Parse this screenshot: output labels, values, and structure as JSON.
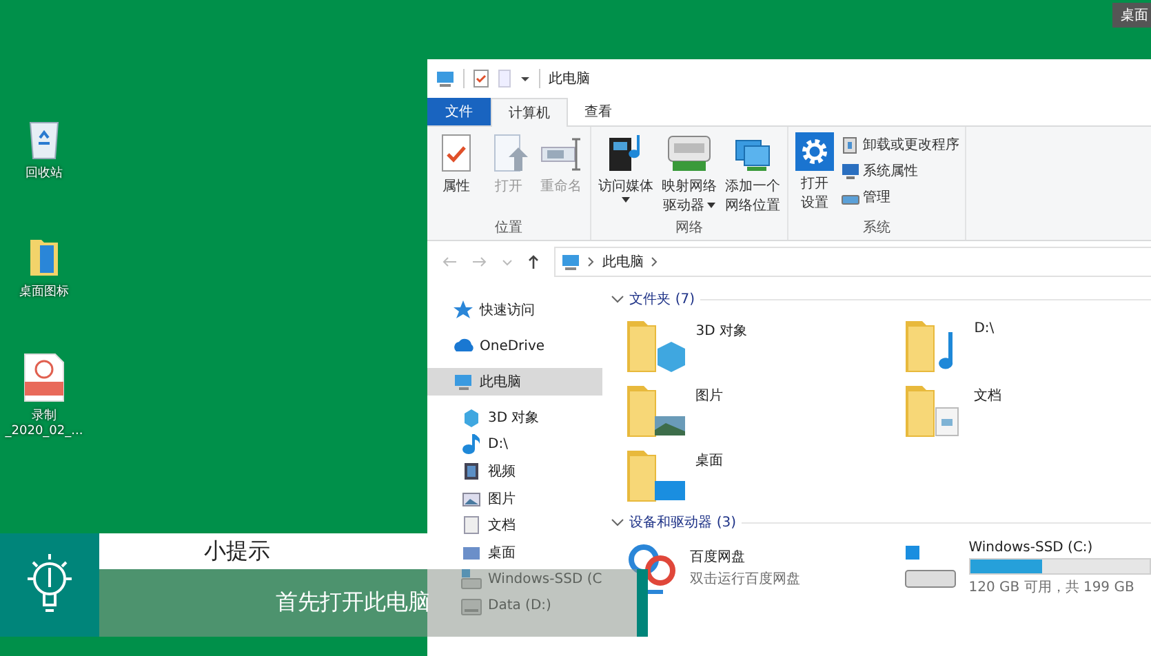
{
  "desktop": {
    "icons": [
      {
        "lines": [
          "回收站"
        ]
      },
      {
        "lines": [
          "桌面图标"
        ]
      },
      {
        "lines": [
          "录制",
          "_2020_02_..."
        ]
      }
    ],
    "corner_label": "桌面"
  },
  "window": {
    "title": "此电脑",
    "tabs": [
      {
        "label": "文件",
        "kind": "file",
        "selected": false
      },
      {
        "label": "计算机",
        "kind": "tab",
        "selected": true
      },
      {
        "label": "查看",
        "kind": "tab",
        "selected": false
      }
    ],
    "ribbon": {
      "groups": [
        {
          "label": "位置",
          "buttons": [
            {
              "lines": [
                "属性"
              ],
              "disabled": false,
              "dropdown": false
            },
            {
              "lines": [
                "打开"
              ],
              "disabled": true,
              "dropdown": false
            },
            {
              "lines": [
                "重命名"
              ],
              "disabled": true,
              "dropdown": false
            }
          ]
        },
        {
          "label": "网络",
          "buttons": [
            {
              "lines": [
                "访问媒体"
              ],
              "disabled": false,
              "dropdown": true
            },
            {
              "lines": [
                "映射网络",
                "驱动器"
              ],
              "disabled": false,
              "dropdown": true
            },
            {
              "lines": [
                "添加一个",
                "网络位置"
              ],
              "disabled": false,
              "dropdown": false
            }
          ]
        },
        {
          "label": "系统",
          "buttons": [
            {
              "lines": [
                "打开",
                "设置"
              ],
              "disabled": false,
              "dropdown": false
            }
          ],
          "small_buttons": [
            {
              "label": "卸载或更改程序"
            },
            {
              "label": "系统属性"
            },
            {
              "label": "管理"
            }
          ]
        }
      ]
    },
    "address": {
      "path": "此电脑"
    },
    "sidebar": {
      "items": [
        {
          "label": "快速访问",
          "selected": false
        },
        {
          "label": "OneDrive",
          "selected": false
        },
        {
          "label": "此电脑",
          "selected": true,
          "children": [
            {
              "label": "3D 对象",
              "selected": false
            },
            {
              "label": "D:\\",
              "selected": false
            },
            {
              "label": "视频",
              "selected": false
            },
            {
              "label": "图片",
              "selected": false
            },
            {
              "label": "文档",
              "selected": false
            },
            {
              "label": "桌面",
              "selected": false
            },
            {
              "label": "Windows-SSD (C",
              "selected": false
            },
            {
              "label": "Data (D:)",
              "selected": false
            }
          ]
        }
      ]
    },
    "sections": [
      {
        "title": "文件夹 (7)",
        "items": [
          {
            "name": "3D 对象",
            "kind": "folder"
          },
          {
            "name": "D:\\",
            "kind": "folder"
          },
          {
            "name": "图片",
            "kind": "folder"
          },
          {
            "name": "文档",
            "kind": "folder"
          },
          {
            "name": "桌面",
            "kind": "folder"
          }
        ]
      },
      {
        "title": "设备和驱动器 (3)",
        "items": [
          {
            "name": "百度网盘",
            "kind": "app",
            "detail": "双击运行百度网盘"
          },
          {
            "name": "Windows-SSD (C:)",
            "kind": "disk",
            "level": 0.4,
            "detail": "120 GB 可用，共 199 GB"
          }
        ]
      }
    ]
  },
  "tip": {
    "title": "小提示",
    "text": "首先打开此电脑"
  }
}
